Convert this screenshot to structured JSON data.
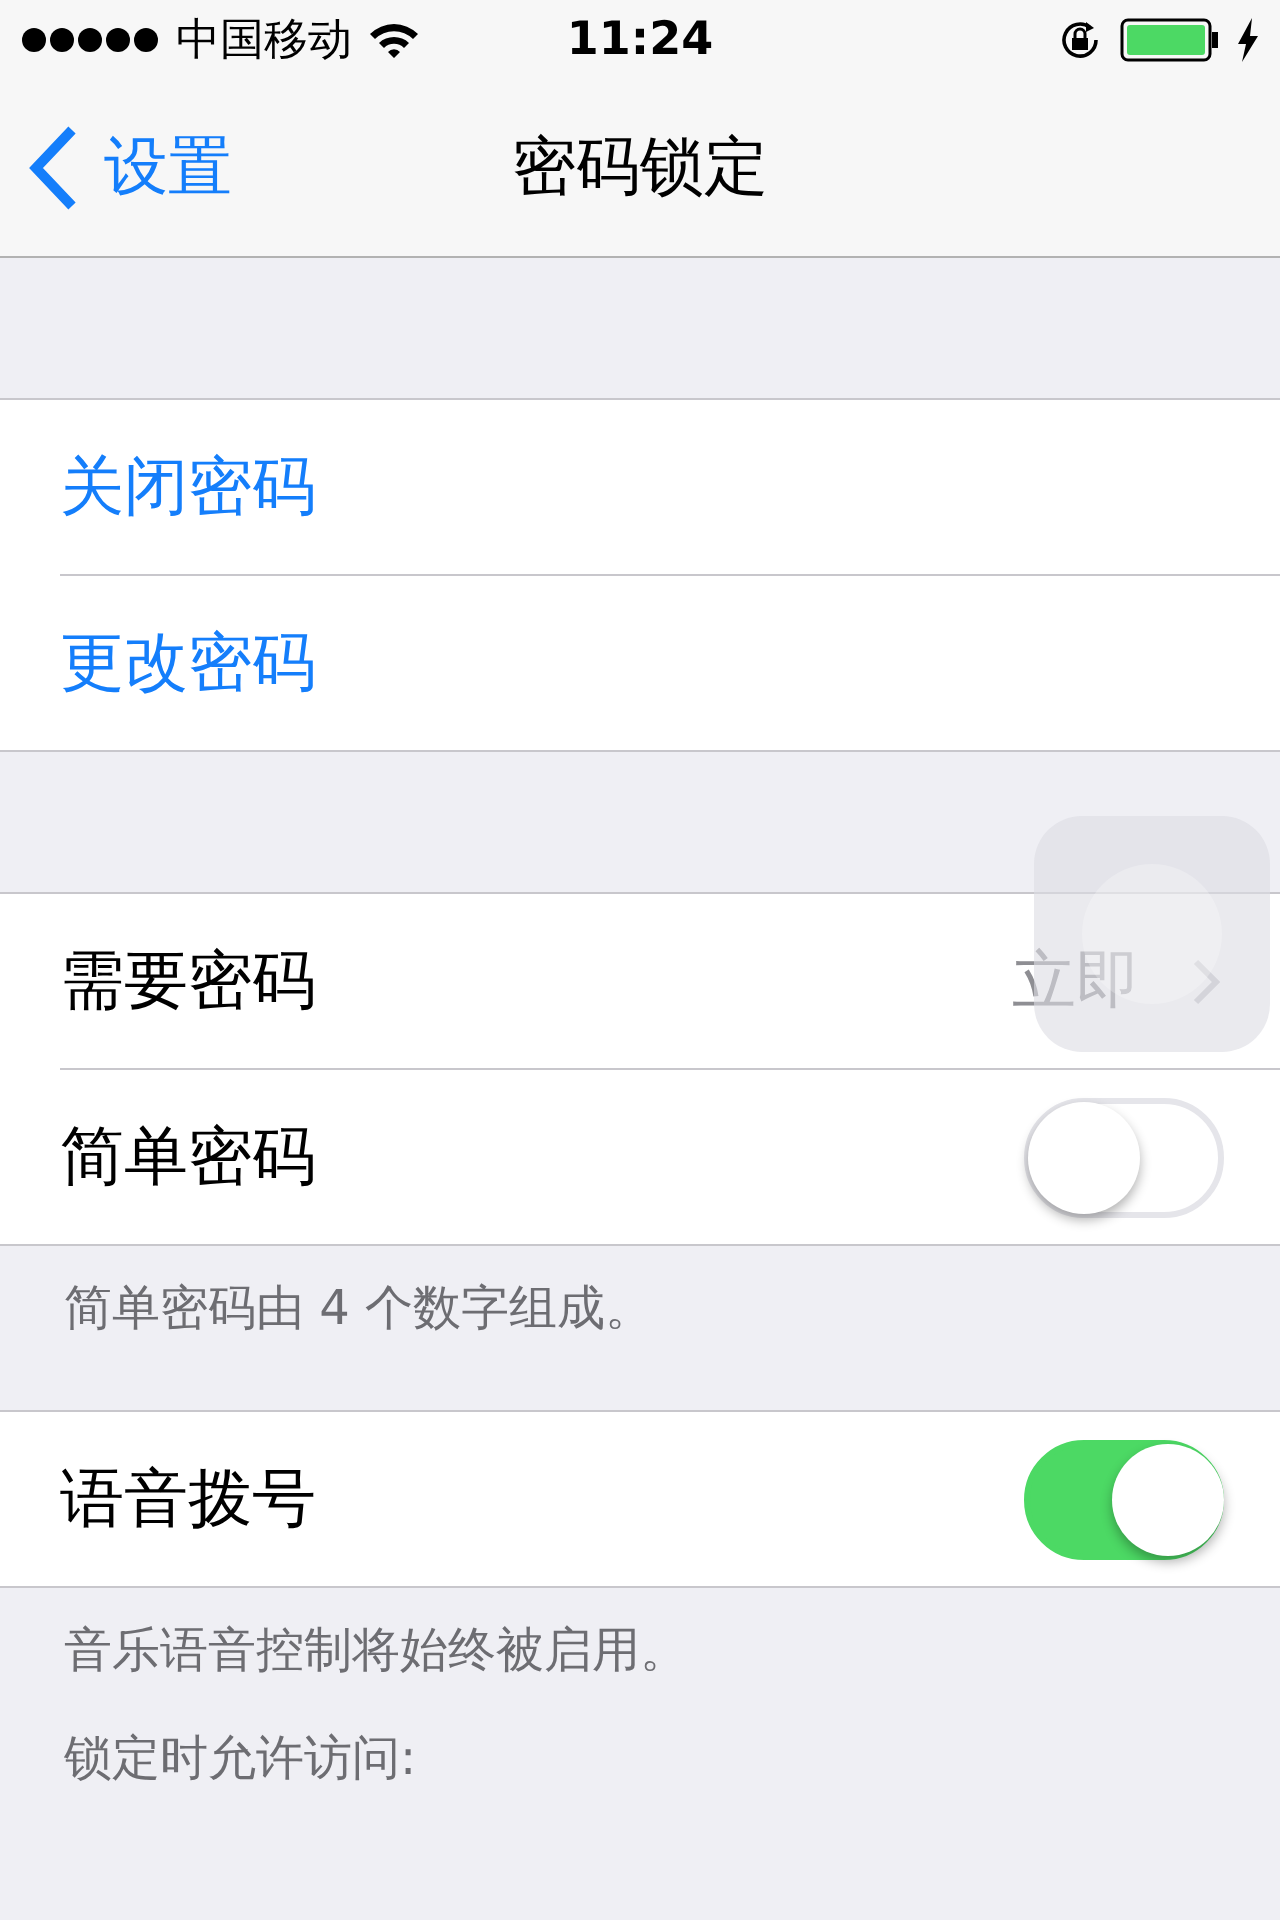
{
  "status_bar": {
    "carrier": "中国移动",
    "time": "11:24"
  },
  "nav": {
    "back": "设置",
    "title": "密码锁定"
  },
  "sections": [
    {
      "rows": [
        {
          "kind": "action",
          "label": "关闭密码"
        },
        {
          "kind": "action",
          "label": "更改密码"
        }
      ]
    },
    {
      "rows": [
        {
          "kind": "disclosure",
          "label": "需要密码",
          "value": "立即"
        },
        {
          "kind": "toggle",
          "label": "简单密码",
          "on": false
        }
      ],
      "footer": "简单密码由 4 个数字组成。"
    },
    {
      "rows": [
        {
          "kind": "toggle",
          "label": "语音拨号",
          "on": true
        }
      ],
      "footer": "音乐语音控制将始终被启用。"
    },
    {
      "header": "锁定时允许访问:"
    }
  ]
}
